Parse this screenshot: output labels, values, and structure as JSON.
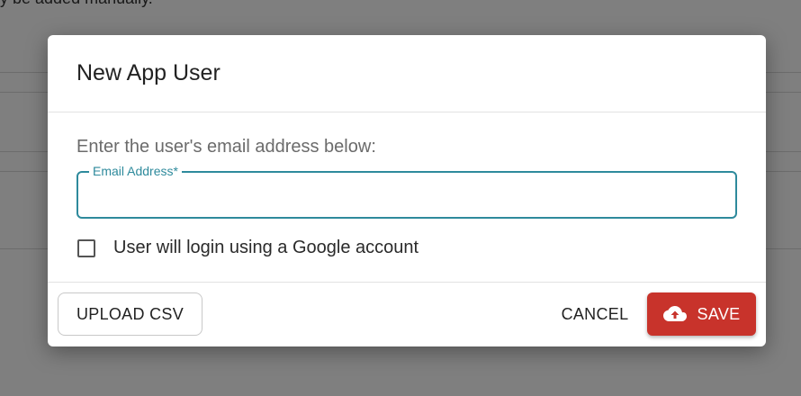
{
  "background": {
    "partial_text": "y be added manually."
  },
  "dialog": {
    "title": "New App User",
    "prompt": "Enter the user's email address below:",
    "email_field": {
      "label": "Email Address*",
      "value": "",
      "placeholder": ""
    },
    "google_checkbox": {
      "label": "User will login using a Google account",
      "checked": false
    },
    "footer": {
      "upload_label": "UPLOAD CSV",
      "cancel_label": "CANCEL",
      "save_label": "SAVE",
      "save_icon": "cloud-upload-icon"
    }
  },
  "colors": {
    "accent_teal": "#2e8a9c",
    "save_red": "#c8332b"
  }
}
